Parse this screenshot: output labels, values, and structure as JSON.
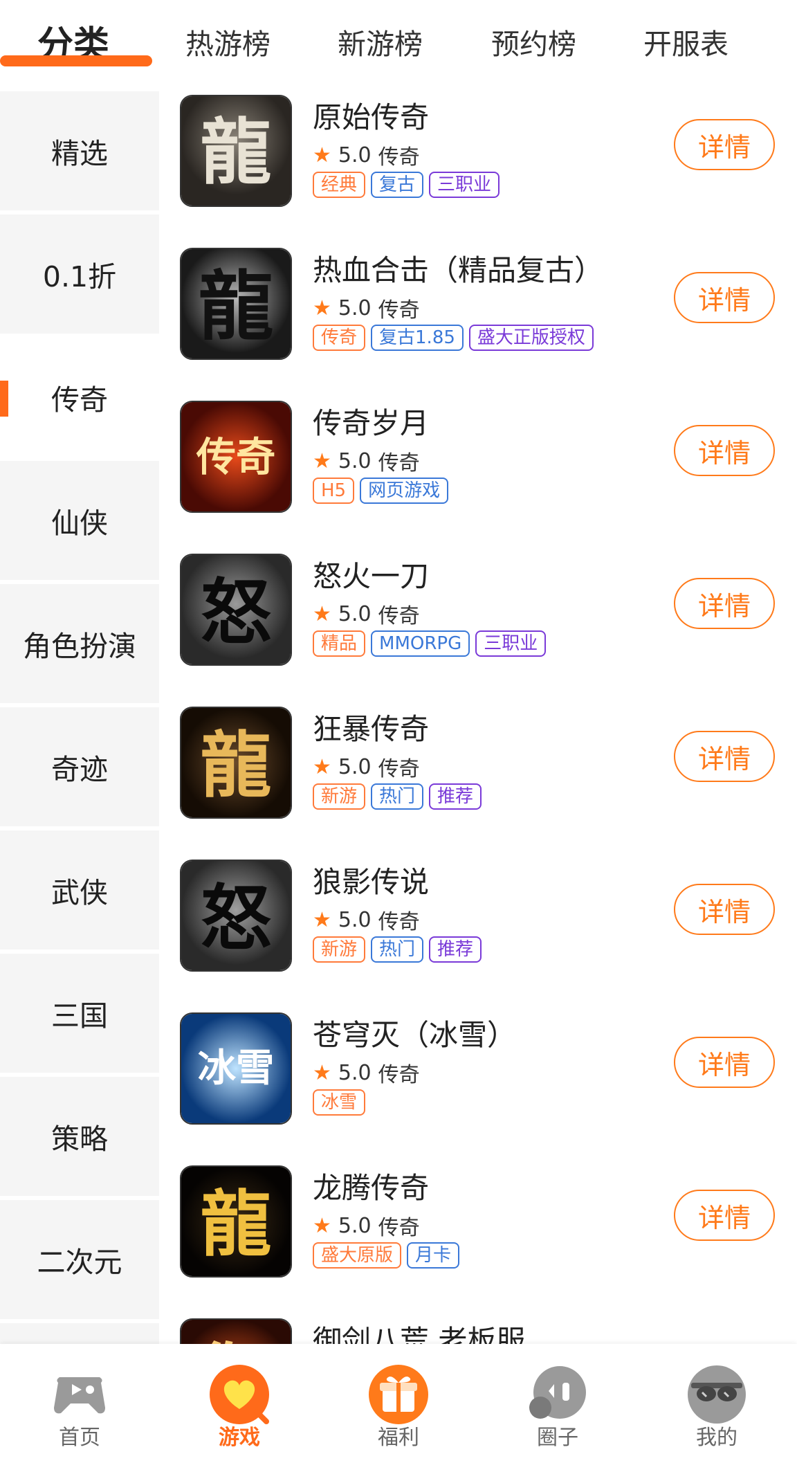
{
  "top_tabs": [
    "分类",
    "热游榜",
    "新游榜",
    "预约榜",
    "开服表"
  ],
  "sidebar": [
    "精选",
    "0.1折",
    "传奇",
    "仙侠",
    "角色扮演",
    "奇迹",
    "武侠",
    "三国",
    "策略",
    "二次元"
  ],
  "games": [
    {
      "title": "原始传奇",
      "rating": "5.0",
      "genre": "传奇",
      "tags": [
        "经典",
        "复古",
        "三职业"
      ],
      "button": "详情"
    },
    {
      "title": "热血合击（精品复古）",
      "rating": "5.0",
      "genre": "传奇",
      "tags": [
        "传奇",
        "复古1.85",
        "盛大正版授权"
      ],
      "button": "详情"
    },
    {
      "title": "传奇岁月",
      "rating": "5.0",
      "genre": "传奇",
      "tags": [
        "H5",
        "网页游戏"
      ],
      "button": "详情"
    },
    {
      "title": "怒火一刀",
      "rating": "5.0",
      "genre": "传奇",
      "tags": [
        "精品",
        "MMORPG",
        "三职业"
      ],
      "button": "详情"
    },
    {
      "title": "狂暴传奇",
      "rating": "5.0",
      "genre": "传奇",
      "tags": [
        "新游",
        "热门",
        "推荐"
      ],
      "button": "详情"
    },
    {
      "title": "狼影传说",
      "rating": "5.0",
      "genre": "传奇",
      "tags": [
        "新游",
        "热门",
        "推荐"
      ],
      "button": "详情"
    },
    {
      "title": "苍穹灭（冰雪）",
      "rating": "5.0",
      "genre": "传奇",
      "tags": [
        "冰雪"
      ],
      "button": "详情"
    },
    {
      "title": "龙腾传奇",
      "rating": "5.0",
      "genre": "传奇",
      "tags": [
        "盛大原版",
        "月卡"
      ],
      "button": "详情"
    },
    {
      "title": "御剑八荒 老板服",
      "rating": "",
      "genre": "",
      "tags": [],
      "button": ""
    }
  ],
  "icon_chars": [
    "龍",
    "龍",
    "传奇",
    "怒",
    "龍",
    "怒",
    "冰雪",
    "龍",
    "御"
  ],
  "bottom_nav": [
    "首页",
    "游戏",
    "福利",
    "圈子",
    "我的"
  ],
  "colors": {
    "accent": "#ff6a1a",
    "tag_orange": "#ff7a3a",
    "tag_blue": "#3a78d8",
    "tag_purple": "#7a3ad8"
  }
}
